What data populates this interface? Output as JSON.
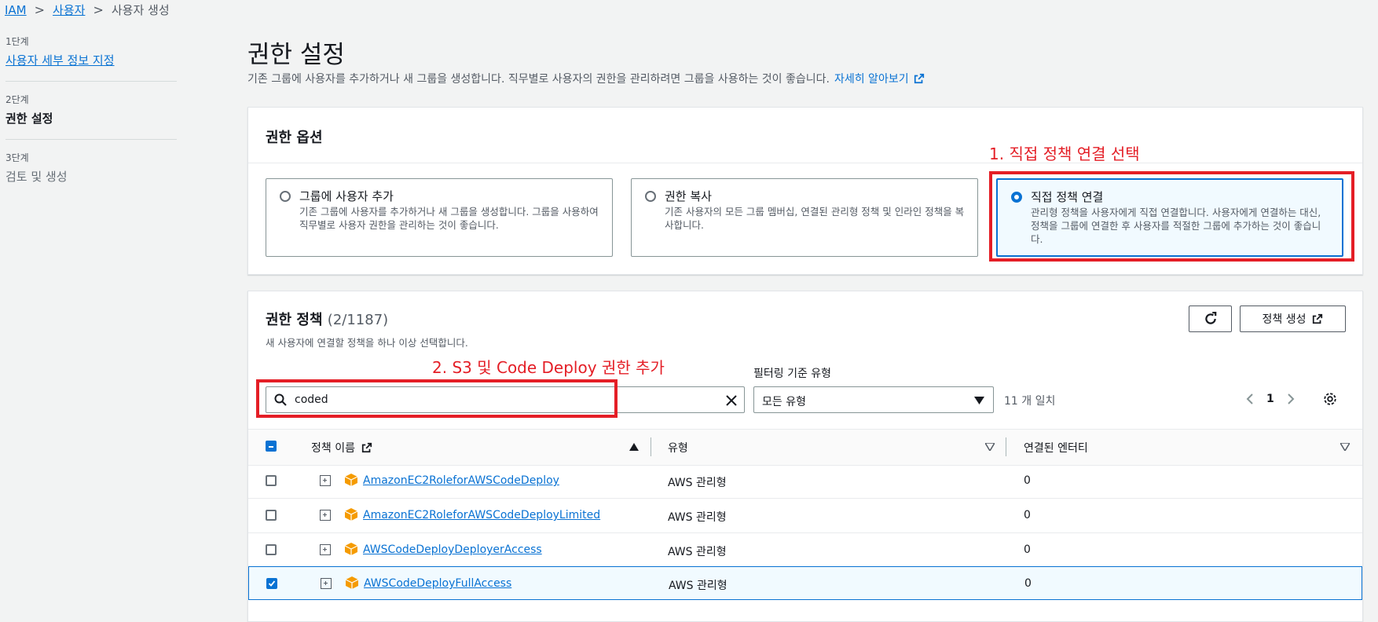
{
  "breadcrumb": {
    "root": "IAM",
    "users": "사용자",
    "current": "사용자 생성"
  },
  "steps": [
    {
      "label": "1단계",
      "title": "사용자 세부 정보 지정"
    },
    {
      "label": "2단계",
      "title": "권한 설정"
    },
    {
      "label": "3단계",
      "title": "검토 및 생성"
    }
  ],
  "header": {
    "title": "권한 설정",
    "description": "기존 그룹에 사용자를 추가하거나 새 그룹을 생성합니다. 직무별로 사용자의 권한을 관리하려면 그룹을 사용하는 것이 좋습니다.",
    "learn_more": "자세히 알아보기"
  },
  "options": {
    "title": "권한 옵션",
    "items": [
      {
        "title": "그룹에 사용자 추가",
        "desc": "기존 그룹에 사용자를 추가하거나 새 그룹을 생성합니다. 그룹을 사용하여 직무별로 사용자 권한을 관리하는 것이 좋습니다."
      },
      {
        "title": "권한 복사",
        "desc": "기존 사용자의 모든 그룹 멤버십, 연결된 관리형 정책 및 인라인 정책을 복사합니다."
      },
      {
        "title": "직접 정책 연결",
        "desc": "관리형 정책을 사용자에게 직접 연결합니다. 사용자에게 연결하는 대신, 정책을 그룹에 연결한 후 사용자를 적절한 그룹에 추가하는 것이 좋습니다."
      }
    ],
    "selected_index": 2
  },
  "annotations": {
    "step1": "1. 직접 정책 연결 선택",
    "step2": "2. S3 및 Code Deploy 권한 추가"
  },
  "policies": {
    "title": "권한 정책",
    "count": "(2/1187)",
    "description": "새 사용자에 연결할 정책을 하나 이상 선택합니다.",
    "create_button": "정책 생성",
    "search_value": "coded",
    "filter_label": "필터링 기준 유형",
    "filter_value": "모든 유형",
    "match_count": "11 개 일치",
    "page": "1",
    "columns": {
      "name": "정책 이름",
      "type": "유형",
      "entities": "연결된 엔터티"
    },
    "rows": [
      {
        "name": "AmazonEC2RoleforAWSCodeDeploy",
        "type": "AWS 관리형",
        "entities": "0",
        "checked": false
      },
      {
        "name": "AmazonEC2RoleforAWSCodeDeployLimited",
        "type": "AWS 관리형",
        "entities": "0",
        "checked": false
      },
      {
        "name": "AWSCodeDeployDeployerAccess",
        "type": "AWS 관리형",
        "entities": "0",
        "checked": false
      },
      {
        "name": "AWSCodeDeployFullAccess",
        "type": "AWS 관리형",
        "entities": "0",
        "checked": true
      }
    ]
  },
  "colors": {
    "link": "#0972d3",
    "annotation": "#e41e26",
    "package": "#f59b00"
  }
}
